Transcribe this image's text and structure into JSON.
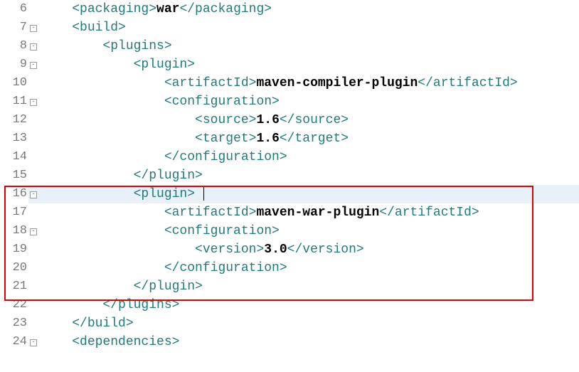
{
  "lines": [
    {
      "num": "6",
      "fold": "",
      "indent": "    ",
      "tokens": [
        {
          "t": "tag",
          "v": "<packaging>"
        },
        {
          "t": "txt",
          "v": "war"
        },
        {
          "t": "tag",
          "v": "</packaging>"
        }
      ],
      "hl": false,
      "cursor": false
    },
    {
      "num": "7",
      "fold": "-",
      "indent": "    ",
      "tokens": [
        {
          "t": "tag",
          "v": "<build>"
        }
      ],
      "hl": false,
      "cursor": false
    },
    {
      "num": "8",
      "fold": "-",
      "indent": "        ",
      "tokens": [
        {
          "t": "tag",
          "v": "<plugins>"
        }
      ],
      "hl": false,
      "cursor": false
    },
    {
      "num": "9",
      "fold": "-",
      "indent": "            ",
      "tokens": [
        {
          "t": "tag",
          "v": "<plugin>"
        }
      ],
      "hl": false,
      "cursor": false
    },
    {
      "num": "10",
      "fold": "",
      "indent": "                ",
      "tokens": [
        {
          "t": "tag",
          "v": "<artifactId>"
        },
        {
          "t": "txt",
          "v": "maven-compiler-plugin"
        },
        {
          "t": "tag",
          "v": "</artifactId>"
        }
      ],
      "hl": false,
      "cursor": false
    },
    {
      "num": "11",
      "fold": "-",
      "indent": "                ",
      "tokens": [
        {
          "t": "tag",
          "v": "<configuration>"
        }
      ],
      "hl": false,
      "cursor": false
    },
    {
      "num": "12",
      "fold": "",
      "indent": "                    ",
      "tokens": [
        {
          "t": "tag",
          "v": "<source>"
        },
        {
          "t": "txt",
          "v": "1.6"
        },
        {
          "t": "tag",
          "v": "</source>"
        }
      ],
      "hl": false,
      "cursor": false
    },
    {
      "num": "13",
      "fold": "",
      "indent": "                    ",
      "tokens": [
        {
          "t": "tag",
          "v": "<target>"
        },
        {
          "t": "txt",
          "v": "1.6"
        },
        {
          "t": "tag",
          "v": "</target>"
        }
      ],
      "hl": false,
      "cursor": false
    },
    {
      "num": "14",
      "fold": "",
      "indent": "                ",
      "tokens": [
        {
          "t": "tag",
          "v": "</configuration>"
        }
      ],
      "hl": false,
      "cursor": false
    },
    {
      "num": "15",
      "fold": "",
      "indent": "            ",
      "tokens": [
        {
          "t": "tag",
          "v": "</plugin>"
        }
      ],
      "hl": false,
      "cursor": false
    },
    {
      "num": "16",
      "fold": "-",
      "indent": "            ",
      "tokens": [
        {
          "t": "tag",
          "v": "<plugin>"
        },
        {
          "t": "txt",
          "v": " "
        }
      ],
      "hl": true,
      "cursor": true
    },
    {
      "num": "17",
      "fold": "",
      "indent": "                ",
      "tokens": [
        {
          "t": "tag",
          "v": "<artifactId>"
        },
        {
          "t": "txt",
          "v": "maven-war-plugin"
        },
        {
          "t": "tag",
          "v": "</artifactId>"
        }
      ],
      "hl": false,
      "cursor": false
    },
    {
      "num": "18",
      "fold": "-",
      "indent": "                ",
      "tokens": [
        {
          "t": "tag",
          "v": "<configuration>"
        }
      ],
      "hl": false,
      "cursor": false
    },
    {
      "num": "19",
      "fold": "",
      "indent": "                    ",
      "tokens": [
        {
          "t": "tag",
          "v": "<version>"
        },
        {
          "t": "txt",
          "v": "3.0"
        },
        {
          "t": "tag",
          "v": "</version>"
        }
      ],
      "hl": false,
      "cursor": false
    },
    {
      "num": "20",
      "fold": "",
      "indent": "                ",
      "tokens": [
        {
          "t": "tag",
          "v": "</configuration>"
        }
      ],
      "hl": false,
      "cursor": false
    },
    {
      "num": "21",
      "fold": "",
      "indent": "            ",
      "tokens": [
        {
          "t": "tag",
          "v": "</plugin>"
        }
      ],
      "hl": false,
      "cursor": false
    },
    {
      "num": "22",
      "fold": "",
      "indent": "        ",
      "tokens": [
        {
          "t": "tag",
          "v": "</plugins>"
        }
      ],
      "hl": false,
      "cursor": false
    },
    {
      "num": "23",
      "fold": "",
      "indent": "    ",
      "tokens": [
        {
          "t": "tag",
          "v": "</build>"
        }
      ],
      "hl": false,
      "cursor": false
    },
    {
      "num": "24",
      "fold": "-",
      "indent": "    ",
      "tokens": [
        {
          "t": "tag",
          "v": "<dependencies>"
        }
      ],
      "hl": false,
      "cursor": false
    }
  ]
}
